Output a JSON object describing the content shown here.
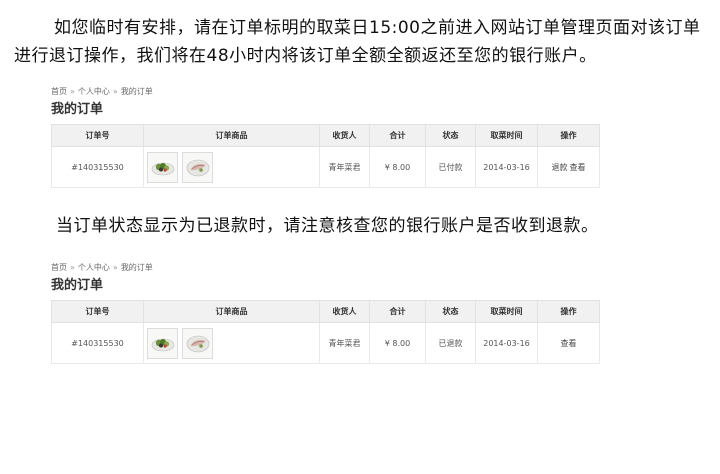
{
  "paragraph1": "如您临时有安排，请在订单标明的取菜日15:00之前进入网站订单管理页面对该订单进行退订操作，我们将在48小时内将该订单全额全额返还至您的银行账户。",
  "paragraph2": "当订单状态显示为已退款时，请注意核查您的银行账户是否收到退款。",
  "shots": [
    {
      "breadcrumb": [
        "首页",
        "个人中心",
        "我的订单"
      ],
      "breadcrumb_sep": "»",
      "title": "我的订单",
      "headers": [
        "订单号",
        "订单商品",
        "收货人",
        "合计",
        "状态",
        "取菜时间",
        "操作"
      ],
      "row": {
        "order_no": "#140315530",
        "recipient": "青年菜君",
        "total": "¥ 8.00",
        "status": "已付款",
        "pickup_time": "2014-03-16",
        "ops": [
          "退款",
          "查看"
        ]
      }
    },
    {
      "breadcrumb": [
        "首页",
        "个人中心",
        "我的订单"
      ],
      "breadcrumb_sep": "»",
      "title": "我的订单",
      "headers": [
        "订单号",
        "订单商品",
        "收货人",
        "合计",
        "状态",
        "取菜时间",
        "操作"
      ],
      "row": {
        "order_no": "#140315530",
        "recipient": "青年菜君",
        "total": "¥ 8.00",
        "status": "已退款",
        "pickup_time": "2014-03-16",
        "ops": [
          "查看"
        ]
      }
    }
  ]
}
